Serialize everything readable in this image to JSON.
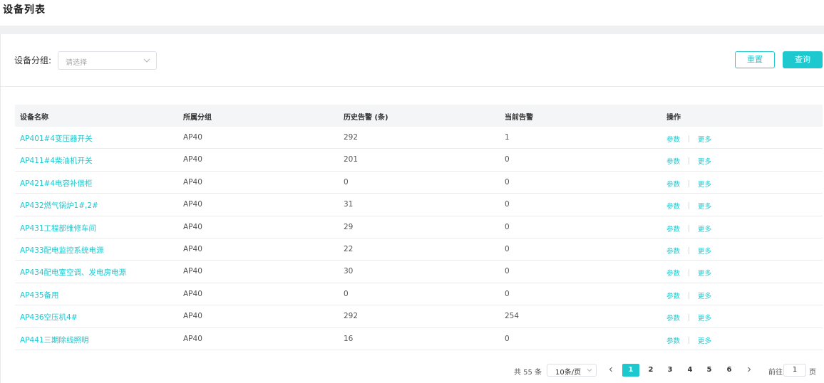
{
  "page": {
    "title": "设备列表"
  },
  "filter": {
    "group_label": "设备分组:",
    "group_placeholder": "请选择",
    "reset_label": "重置",
    "query_label": "查询"
  },
  "table": {
    "headers": [
      "设备名称",
      "所属分组",
      "历史告警 (条)",
      "当前告警",
      "操作"
    ],
    "rows": [
      {
        "name": "AP401#4变压器开关",
        "group": "AP40",
        "history": "292",
        "current": "1"
      },
      {
        "name": "AP411#4柴油机开关",
        "group": "AP40",
        "history": "201",
        "current": "0"
      },
      {
        "name": "AP421#4电容补偿柜",
        "group": "AP40",
        "history": "0",
        "current": "0"
      },
      {
        "name": "AP432燃气锅炉1#,2#",
        "group": "AP40",
        "history": "31",
        "current": "0"
      },
      {
        "name": "AP431工程部维修车间",
        "group": "AP40",
        "history": "29",
        "current": "0"
      },
      {
        "name": "AP433配电监控系统电源",
        "group": "AP40",
        "history": "22",
        "current": "0"
      },
      {
        "name": "AP434配电室空调、发电房电源",
        "group": "AP40",
        "history": "30",
        "current": "0"
      },
      {
        "name": "AP435备用",
        "group": "AP40",
        "history": "0",
        "current": "0"
      },
      {
        "name": "AP436空压机4#",
        "group": "AP40",
        "history": "292",
        "current": "254"
      },
      {
        "name": "AP441三期除线照明",
        "group": "AP40",
        "history": "16",
        "current": "0"
      }
    ],
    "action_params": "参数",
    "action_more": "更多"
  },
  "pagination": {
    "total_text": "共 55 条",
    "page_size": "10条/页",
    "pages": [
      "1",
      "2",
      "3",
      "4",
      "5",
      "6"
    ],
    "current_page": "1",
    "goto_label": "前往",
    "goto_value": "1",
    "page_suffix": "页"
  },
  "colors": {
    "accent": "#1ec8cf",
    "header_bg": "#f4f5f7",
    "gap_bg": "#eff0f2"
  },
  "icons": {
    "select_arrow": "chevron-down-icon",
    "prev": "chevron-left-icon",
    "next": "chevron-right-icon"
  }
}
